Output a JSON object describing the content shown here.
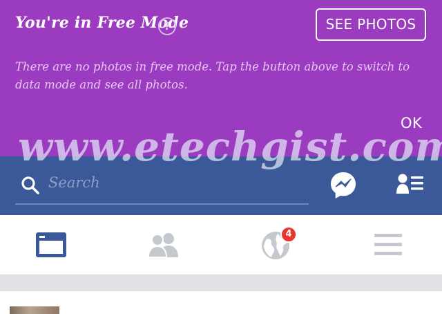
{
  "banner": {
    "title": "You're in Free Mode",
    "help_icon": "question-mark-icon",
    "help_glyph": "?",
    "see_photos_label": "SEE PHOTOS",
    "message": "There are no photos in free mode. Tap the button above to switch to data mode and see all photos.",
    "ok_label": "OK",
    "background_color": "#9b3bc0"
  },
  "header": {
    "search_placeholder": "Search",
    "icons": [
      "search-icon",
      "messenger-icon",
      "friend-requests-icon"
    ],
    "background_color": "#3b5998"
  },
  "watermark": {
    "text": "www.etechgist.com"
  },
  "tabs": [
    {
      "name": "news-feed",
      "icon": "news-feed-icon",
      "active": true
    },
    {
      "name": "friends",
      "icon": "friends-icon",
      "active": false
    },
    {
      "name": "notifications",
      "icon": "globe-icon",
      "active": false,
      "badge": "4"
    },
    {
      "name": "menu",
      "icon": "hamburger-menu-icon",
      "active": false
    }
  ],
  "colors": {
    "active_tab": "#3b5998",
    "inactive_tab": "#c5c8cf",
    "badge": "#e8352b"
  }
}
